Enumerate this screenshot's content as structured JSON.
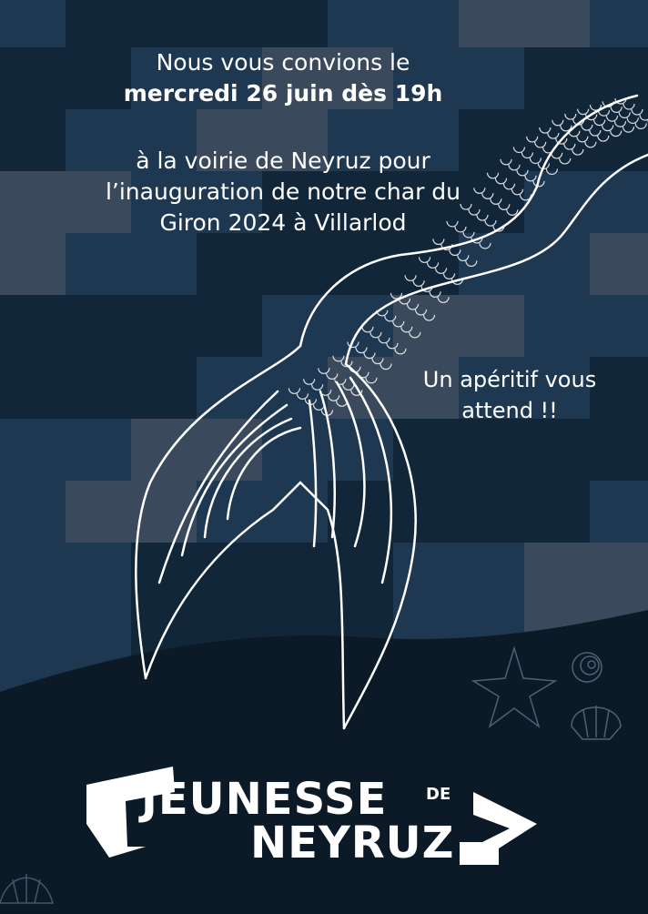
{
  "invitation": {
    "line1": "Nous vous convions le",
    "line2_bold": "mercredi 26 juin dès 19h",
    "place_lines": [
      "à la voirie de Neyruz pour",
      "l’inauguration de notre char du",
      "Giron 2024 à Villarlod"
    ]
  },
  "aperitif": {
    "lines": [
      "Un apéritif vous",
      "attend !!"
    ]
  },
  "logo": {
    "word1": "JEUNESSE",
    "small": "DE",
    "word2": "NEYRUZ"
  },
  "colors": {
    "background": "#0c1a28",
    "scale_dark": "#12263a",
    "scale_mid": "#1e3852",
    "scale_light": "#3a4a5c",
    "ink": "#ffffff"
  },
  "icons": [
    "mermaid-tail-illustration",
    "starfish-icon",
    "seashell-icon",
    "shell-icon"
  ]
}
